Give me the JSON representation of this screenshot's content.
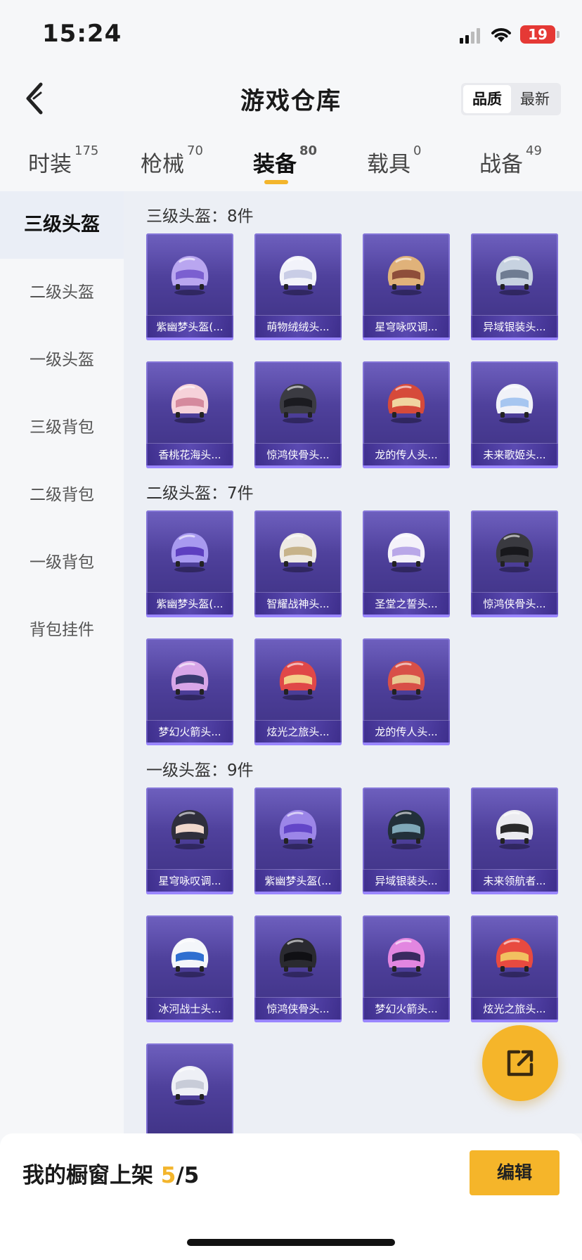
{
  "status_bar": {
    "time": "15:24",
    "battery": "19"
  },
  "header": {
    "title": "游戏仓库",
    "sort": [
      "品质",
      "最新"
    ]
  },
  "tabs": [
    {
      "label": "时装",
      "count": "175"
    },
    {
      "label": "枪械",
      "count": "70"
    },
    {
      "label": "装备",
      "count": "80"
    },
    {
      "label": "载具",
      "count": "0"
    },
    {
      "label": "战备",
      "count": "49"
    }
  ],
  "sidebar": [
    "三级头盔",
    "二级头盔",
    "一级头盔",
    "三级背包",
    "二级背包",
    "一级背包",
    "背包挂件"
  ],
  "groups": [
    {
      "title": "三级头盔：8件",
      "items": [
        "紫幽梦头盔(...",
        "萌物绒绒头...",
        "星穹咏叹调...",
        "异域银装头...",
        "香桃花海头...",
        "惊鸿侠骨头...",
        "龙的传人头...",
        "未来歌姬头..."
      ]
    },
    {
      "title": "二级头盔：7件",
      "items": [
        "紫幽梦头盔(...",
        "智耀战神头...",
        "圣堂之誓头...",
        "惊鸿侠骨头...",
        "梦幻火箭头...",
        "炫光之旅头...",
        "龙的传人头..."
      ]
    },
    {
      "title": "一级头盔：9件",
      "items": [
        "星穹咏叹调...",
        "紫幽梦头盔(...",
        "异域银装头...",
        "未来领航者...",
        "冰河战士头...",
        "惊鸿侠骨头...",
        "梦幻火箭头...",
        "炫光之旅头...",
        ""
      ]
    }
  ],
  "bottom": {
    "shelf_label": "我的橱窗上架",
    "shelf_current": "5",
    "shelf_total": "/5",
    "edit_label": "编辑"
  },
  "helmet_colors": [
    [
      "#b9a6f0",
      "#7b5fd0"
    ],
    [
      "#f2f3fa",
      "#c9cde6"
    ],
    [
      "#e0b27a",
      "#8e4e3a"
    ],
    [
      "#c7d2e0",
      "#6f7c92"
    ],
    [
      "#f6d2da",
      "#d58a9e"
    ],
    [
      "#3b3b42",
      "#1b1b20"
    ],
    [
      "#d64a3a",
      "#f0d4a0"
    ],
    [
      "#f0f2f8",
      "#a6c6f0"
    ],
    [
      "#a89af0",
      "#5d3fc0"
    ],
    [
      "#eeeae4",
      "#c7b38a"
    ],
    [
      "#f4f2fa",
      "#b9a8e8"
    ],
    [
      "#3a3a40",
      "#18181c"
    ],
    [
      "#d8a6e8",
      "#3a3a70"
    ],
    [
      "#e04848",
      "#f4cf8a"
    ],
    [
      "#d85048",
      "#e8c890"
    ],
    [
      "#2f2f3c",
      "#f0d8cc"
    ],
    [
      "#9c86e8",
      "#6346c8"
    ],
    [
      "#22303a",
      "#7fa8b8"
    ],
    [
      "#ececf0",
      "#2a2a2a"
    ],
    [
      "#f4f6fa",
      "#2f6fd0"
    ],
    [
      "#2a2a30",
      "#101014"
    ],
    [
      "#e286e0",
      "#3a2a60"
    ],
    [
      "#e84a40",
      "#f2c060"
    ],
    [
      "#eef0f6",
      "#c8ccd8"
    ]
  ]
}
